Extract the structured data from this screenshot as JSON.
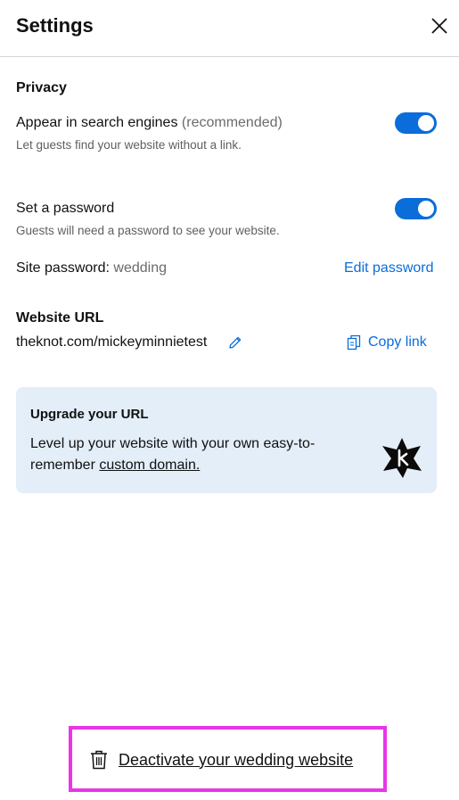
{
  "header": {
    "title": "Settings",
    "close_icon": "close-icon"
  },
  "privacy": {
    "heading": "Privacy",
    "search_engines": {
      "label": "Appear in search engines",
      "label_suffix": "(recommended)",
      "description": "Let guests find your website without a link.",
      "enabled": true
    },
    "password": {
      "label": "Set a password",
      "description": "Guests will need a password to see your website.",
      "enabled": true,
      "site_password_label": "Site password:",
      "site_password_value": "wedding",
      "edit_link": "Edit password"
    }
  },
  "website_url": {
    "heading": "Website URL",
    "url": "theknot.com/mickeyminnietest",
    "edit_icon": "pencil-icon",
    "copy_label": "Copy link",
    "copy_icon": "copy-icon"
  },
  "upgrade": {
    "title": "Upgrade your URL",
    "body": "Level up your website with your own easy-to-remember",
    "link": "custom domain.",
    "badge_icon": "knot-badge-icon"
  },
  "deactivate": {
    "label": "Deactivate your wedding website",
    "icon": "trash-icon"
  },
  "colors": {
    "accent": "#0a6dd9",
    "highlight_border": "#ea35e8",
    "upgrade_bg": "#e3eef9"
  }
}
